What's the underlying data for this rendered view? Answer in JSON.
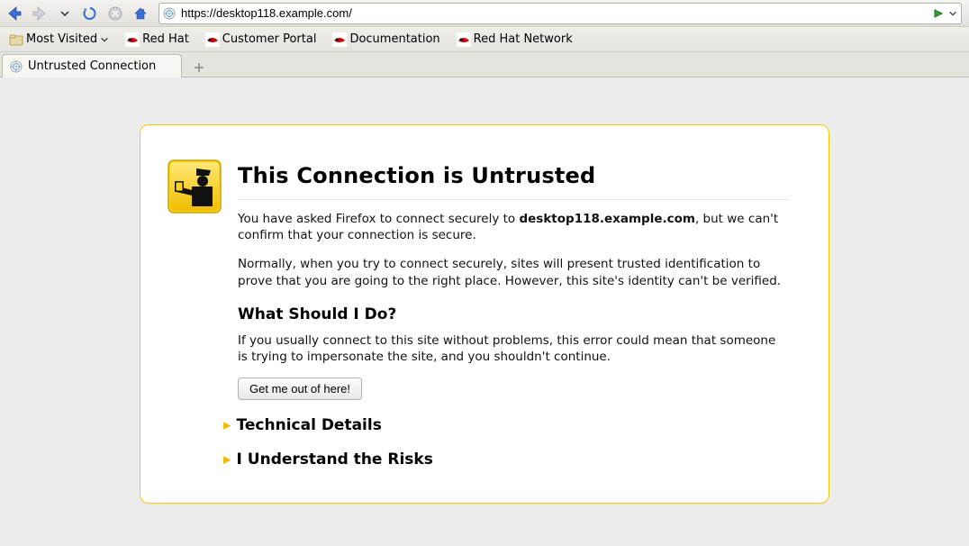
{
  "nav": {
    "url": "https://desktop118.example.com/"
  },
  "bookmarks": {
    "most_visited": "Most Visited",
    "items": [
      "Red Hat",
      "Customer Portal",
      "Documentation",
      "Red Hat Network"
    ]
  },
  "tab": {
    "title": "Untrusted Connection"
  },
  "error": {
    "title": "This Connection is Untrusted",
    "intro_pre": "You have asked Firefox to connect securely to ",
    "host": "desktop118.example.com",
    "intro_post": ", but we can't confirm that your connection is secure.",
    "para2": "Normally, when you try to connect securely, sites will present trusted identification to prove that you are going to the right place. However, this site's identity can't be verified.",
    "h2": "What Should I Do?",
    "para3": "If you usually connect to this site without problems, this error could mean that someone is trying to impersonate the site, and you shouldn't continue.",
    "button": "Get me out of here!",
    "tech": "Technical Details",
    "risks": "I Understand the Risks"
  }
}
